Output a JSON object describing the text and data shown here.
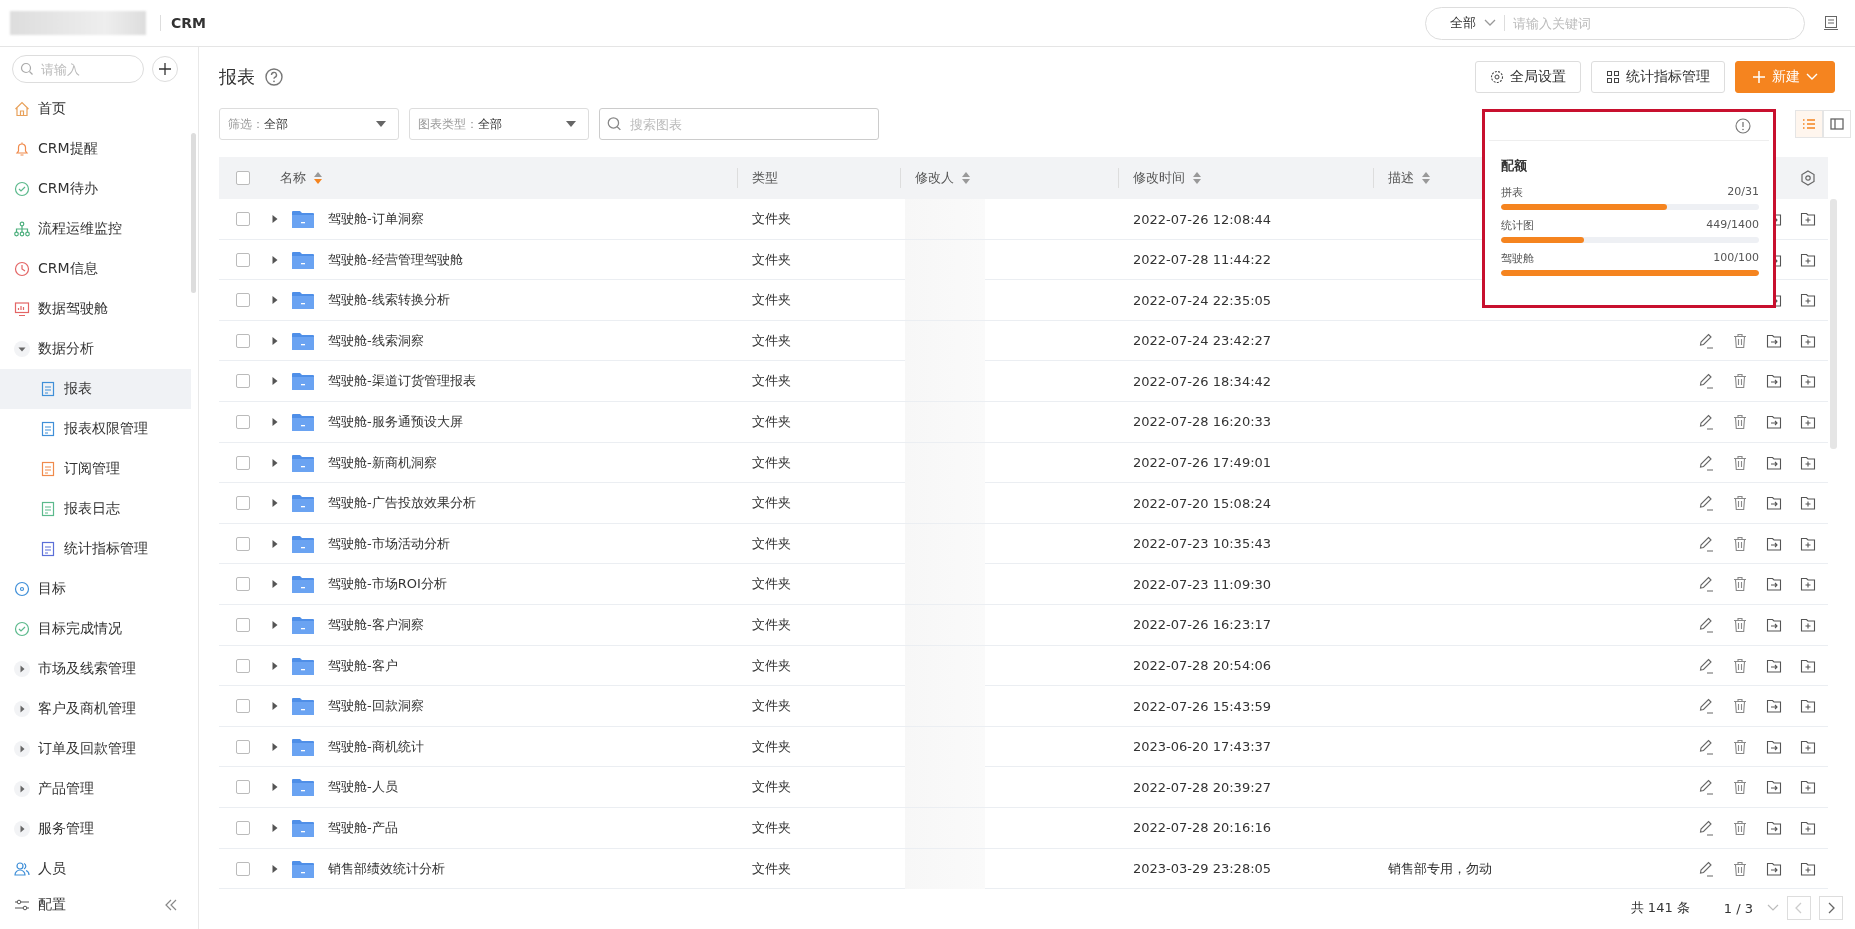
{
  "topbar": {
    "app_name": "CRM",
    "scope": "全部",
    "search": {
      "placeholder": "请输入关键词"
    }
  },
  "sidebar": {
    "search": {
      "placeholder": "请输入"
    },
    "items": [
      {
        "kind": "link",
        "label": "首页",
        "selected": false
      },
      {
        "kind": "link",
        "label": "CRM提醒",
        "selected": false
      },
      {
        "kind": "link",
        "label": "CRM待办",
        "selected": false
      },
      {
        "kind": "link",
        "label": "流程运维监控",
        "selected": false
      },
      {
        "kind": "link",
        "label": "CRM信息",
        "selected": false
      },
      {
        "kind": "link",
        "label": "数据驾驶舱",
        "selected": false
      },
      {
        "kind": "group",
        "label": "数据分析",
        "expanded": true,
        "children": [
          {
            "label": "报表",
            "selected": true
          },
          {
            "label": "报表权限管理",
            "selected": false
          },
          {
            "label": "订阅管理",
            "selected": false
          },
          {
            "label": "报表日志",
            "selected": false
          },
          {
            "label": "统计指标管理",
            "selected": false
          }
        ]
      },
      {
        "kind": "link",
        "label": "目标",
        "selected": false
      },
      {
        "kind": "link",
        "label": "目标完成情况",
        "selected": false
      },
      {
        "kind": "group",
        "label": "市场及线索管理",
        "expanded": false
      },
      {
        "kind": "group",
        "label": "客户及商机管理",
        "expanded": false
      },
      {
        "kind": "group",
        "label": "订单及回款管理",
        "expanded": false
      },
      {
        "kind": "group",
        "label": "产品管理",
        "expanded": false
      },
      {
        "kind": "group",
        "label": "服务管理",
        "expanded": false
      },
      {
        "kind": "link",
        "label": "人员",
        "selected": false
      }
    ],
    "footer": "配置"
  },
  "page": {
    "title": "报表",
    "buttons": [
      "全局设置",
      "统计指标管理",
      "新建"
    ],
    "filters": [
      {
        "label": "筛选：",
        "value": "全部"
      },
      {
        "label": "图表类型：",
        "value": "全部"
      }
    ],
    "search": {
      "placeholder": "搜索图表"
    },
    "views": [
      {
        "selected": true
      },
      {
        "selected": false
      }
    ]
  },
  "quota": {
    "title": "配额",
    "items": [
      {
        "label": "拼表",
        "reading": "20/31",
        "level": 0.645
      },
      {
        "label": "统计图",
        "reading": "449/1400",
        "level": 0.32
      },
      {
        "label": "驾驶舱",
        "reading": "100/100",
        "level": 1
      }
    ]
  },
  "table": {
    "header_checked": false,
    "columns": [
      {
        "label": "名称",
        "sortable": true,
        "sorted": true
      },
      {
        "label": "类型",
        "sortable": false
      },
      {
        "label": "修改人",
        "sortable": true,
        "sorted": false
      },
      {
        "label": "修改时间",
        "sortable": true,
        "sorted": false
      },
      {
        "label": "描述",
        "sortable": true,
        "sorted": false
      }
    ],
    "rows": [
      {
        "checked": false,
        "name": "驾驶舱-订单洞察",
        "type": "文件夹",
        "time": "2022-07-26 12:08:44"
      },
      {
        "checked": false,
        "name": "驾驶舱-经营管理驾驶舱",
        "type": "文件夹",
        "time": "2022-07-28 11:44:22"
      },
      {
        "checked": false,
        "name": "驾驶舱-线索转换分析",
        "type": "文件夹",
        "time": "2022-07-24 22:35:05"
      },
      {
        "checked": false,
        "name": "驾驶舱-线索洞察",
        "type": "文件夹",
        "time": "2022-07-24 23:42:27"
      },
      {
        "checked": false,
        "name": "驾驶舱-渠道订货管理报表",
        "type": "文件夹",
        "time": "2022-07-26 18:34:42"
      },
      {
        "checked": false,
        "name": "驾驶舱-服务通预设大屏",
        "type": "文件夹",
        "time": "2022-07-28 16:20:33"
      },
      {
        "checked": false,
        "name": "驾驶舱-新商机洞察",
        "type": "文件夹",
        "time": "2022-07-26 17:49:01"
      },
      {
        "checked": false,
        "name": "驾驶舱-广告投放效果分析",
        "type": "文件夹",
        "time": "2022-07-20 15:08:24"
      },
      {
        "checked": false,
        "name": "驾驶舱-市场活动分析",
        "type": "文件夹",
        "time": "2022-07-23 10:35:43"
      },
      {
        "checked": false,
        "name": "驾驶舱-市场ROI分析",
        "type": "文件夹",
        "time": "2022-07-23 11:09:30"
      },
      {
        "checked": false,
        "name": "驾驶舱-客户洞察",
        "type": "文件夹",
        "time": "2022-07-26 16:23:17"
      },
      {
        "checked": false,
        "name": "驾驶舱-客户",
        "type": "文件夹",
        "time": "2022-07-28 20:54:06"
      },
      {
        "checked": false,
        "name": "驾驶舱-回款洞察",
        "type": "文件夹",
        "time": "2022-07-26 15:43:59"
      },
      {
        "checked": false,
        "name": "驾驶舱-商机统计",
        "type": "文件夹",
        "time": "2023-06-20 17:43:37"
      },
      {
        "checked": false,
        "name": "驾驶舱-人员",
        "type": "文件夹",
        "time": "2022-07-28 20:39:27"
      },
      {
        "checked": false,
        "name": "驾驶舱-产品",
        "type": "文件夹",
        "time": "2022-07-28 20:16:16"
      },
      {
        "checked": false,
        "name": "销售部绩效统计分析",
        "type": "文件夹",
        "time": "2023-03-29 23:28:05",
        "description": "销售部专用，勿动"
      }
    ]
  },
  "pagination": {
    "total": "共 141 条",
    "page": "1 / 3"
  }
}
